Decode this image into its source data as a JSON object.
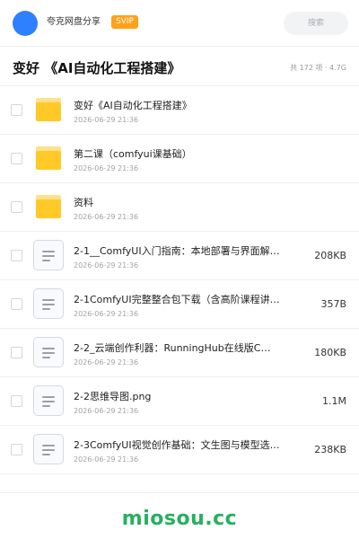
{
  "header": {
    "share_name": "夸克网盘分享",
    "badge": "SVIP",
    "search_placeholder": "搜索"
  },
  "folder": {
    "title": "变好 《AI自动化工程搭建》",
    "meta": "共 172 项 · 4.7G"
  },
  "files": [
    {
      "type": "folder",
      "icon": "folder-icon",
      "name": "变好《AI自动化工程搭建》",
      "date": "2026-06-29 21:36",
      "size": ""
    },
    {
      "type": "folder",
      "icon": "folder-icon",
      "name": "第二课（comfyui课基础）",
      "date": "2026-06-29 21:36",
      "size": ""
    },
    {
      "type": "folder",
      "icon": "folder-icon",
      "name": "资料",
      "date": "2026-06-29 21:36",
      "size": ""
    },
    {
      "type": "file",
      "icon": "document-icon",
      "name": "2-1__ComfyUI入门指南：本地部署与界面解…",
      "date": "2026-06-29 21:36",
      "size": "208KB"
    },
    {
      "type": "file",
      "icon": "document-icon",
      "name": "2-1ComfyUI完整整合包下载（含高阶课程讲到…",
      "date": "2026-06-29 21:36",
      "size": "357B"
    },
    {
      "type": "file",
      "icon": "document-icon",
      "name": "2-2_云端创作利器：RunningHub在线版C…",
      "date": "2026-06-29 21:36",
      "size": "180KB"
    },
    {
      "type": "file",
      "icon": "document-icon",
      "name": "2-2思维导图.png",
      "date": "2026-06-29 21:36",
      "size": "1.1M"
    },
    {
      "type": "file",
      "icon": "document-icon",
      "name": "2-3ComfyUI视觉创作基础：文生图与模型选择…",
      "date": "2026-06-29 21:36",
      "size": "238KB"
    }
  ],
  "footer": {
    "watermark": "miosou.cc"
  },
  "colors": {
    "accent": "#2f80ff",
    "svip": "#ffa11a",
    "folder": "#ffca28",
    "watermark": "#27b05e"
  }
}
